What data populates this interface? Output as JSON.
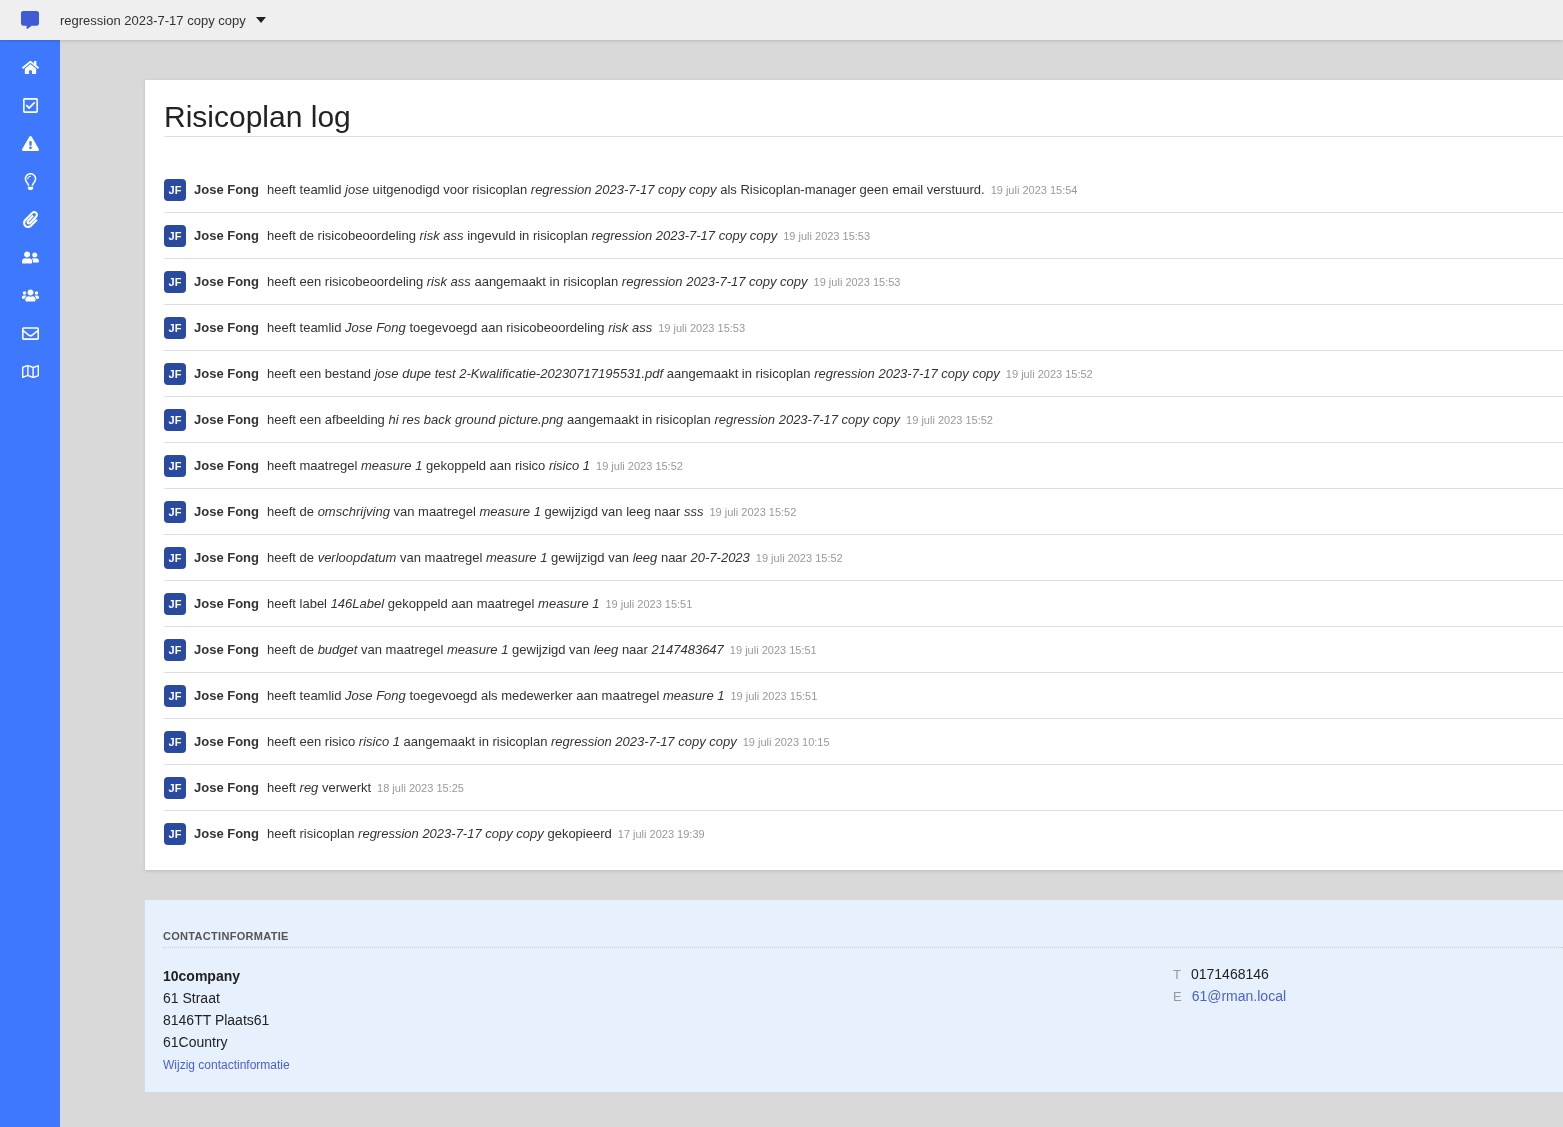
{
  "topbar": {
    "plan_selector": "regression 2023-7-17 copy copy"
  },
  "page": {
    "title": "Risicoplan log"
  },
  "log_entries": [
    {
      "initials": "JF",
      "user": "Jose Fong",
      "message": "heeft teamlid *jose* uitgenodigd voor risicoplan *regression 2023-7-17 copy copy* als Risicoplan-manager geen email verstuurd.",
      "time": "19 juli 2023 15:54"
    },
    {
      "initials": "JF",
      "user": "Jose Fong",
      "message": "heeft de risicobeoordeling *risk ass* ingevuld in risicoplan *regression 2023-7-17 copy copy*",
      "time": "19 juli 2023 15:53"
    },
    {
      "initials": "JF",
      "user": "Jose Fong",
      "message": "heeft een risicobeoordeling *risk ass* aangemaakt in risicoplan *regression 2023-7-17 copy copy*",
      "time": "19 juli 2023 15:53"
    },
    {
      "initials": "JF",
      "user": "Jose Fong",
      "message": "heeft teamlid *Jose Fong* toegevoegd aan risicobeoordeling *risk ass*",
      "time": "19 juli 2023 15:53"
    },
    {
      "initials": "JF",
      "user": "Jose Fong",
      "message": "heeft een bestand *jose dupe test 2-Kwalificatie-20230717195531.pdf* aangemaakt in risicoplan *regression 2023-7-17 copy copy*",
      "time": "19 juli 2023 15:52"
    },
    {
      "initials": "JF",
      "user": "Jose Fong",
      "message": "heeft een afbeelding *hi res back ground picture.png* aangemaakt in risicoplan *regression 2023-7-17 copy copy*",
      "time": "19 juli 2023 15:52"
    },
    {
      "initials": "JF",
      "user": "Jose Fong",
      "message": "heeft maatregel *measure 1* gekoppeld aan risico *risico 1*",
      "time": "19 juli 2023 15:52"
    },
    {
      "initials": "JF",
      "user": "Jose Fong",
      "message": "heeft de *omschrijving* van maatregel *measure 1* gewijzigd van leeg naar *sss*",
      "time": "19 juli 2023 15:52"
    },
    {
      "initials": "JF",
      "user": "Jose Fong",
      "message": "heeft de *verloopdatum* van maatregel *measure 1* gewijzigd van *leeg* naar *20-7-2023*",
      "time": "19 juli 2023 15:52"
    },
    {
      "initials": "JF",
      "user": "Jose Fong",
      "message": "heeft label *146Label* gekoppeld aan maatregel *measure 1*",
      "time": "19 juli 2023 15:51"
    },
    {
      "initials": "JF",
      "user": "Jose Fong",
      "message": "heeft de *budget* van maatregel *measure 1* gewijzigd van *leeg* naar *2147483647*",
      "time": "19 juli 2023 15:51"
    },
    {
      "initials": "JF",
      "user": "Jose Fong",
      "message": "heeft teamlid *Jose Fong* toegevoegd als medewerker aan maatregel *measure 1*",
      "time": "19 juli 2023 15:51"
    },
    {
      "initials": "JF",
      "user": "Jose Fong",
      "message": "heeft een risico *risico 1* aangemaakt in risicoplan *regression 2023-7-17 copy copy*",
      "time": "19 juli 2023 10:15"
    },
    {
      "initials": "JF",
      "user": "Jose Fong",
      "message": "heeft *reg* verwerkt",
      "time": "18 juli 2023 15:25"
    },
    {
      "initials": "JF",
      "user": "Jose Fong",
      "message": "heeft risicoplan *regression 2023-7-17 copy copy* gekopieerd",
      "time": "17 juli 2023 19:39"
    }
  ],
  "contact": {
    "heading": "CONTACTINFORMATIE",
    "company": "10company",
    "address_lines": [
      "61 Straat",
      "8146TT Plaats61",
      "61Country"
    ],
    "edit_link": "Wijzig contactinformatie",
    "phone_label": "T",
    "phone": "0171468146",
    "email_label": "E",
    "email": "61@rman.local"
  }
}
